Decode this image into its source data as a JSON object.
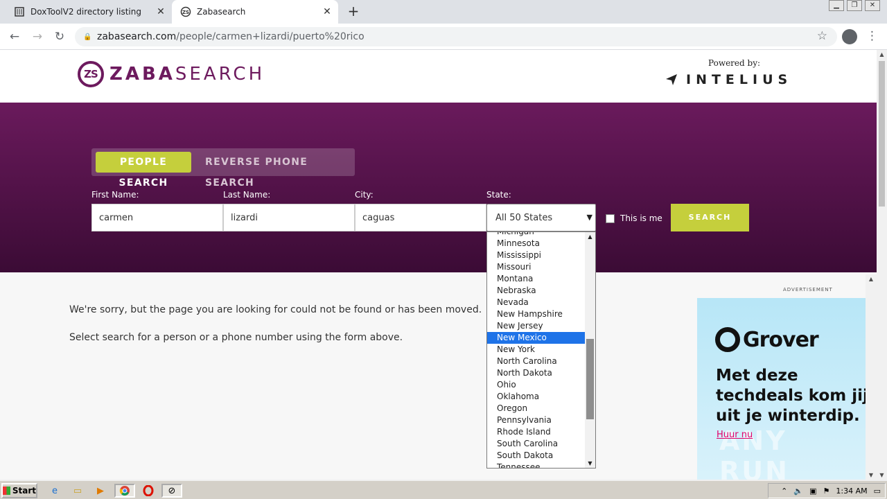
{
  "browser": {
    "tabs": [
      {
        "title": "DoxToolV2 directory listing",
        "icon": "archive-icon"
      },
      {
        "title": "Zabasearch",
        "icon": "zabasearch-favicon"
      }
    ],
    "url_host": "zabasearch.com",
    "url_path": "/people/carmen+lizardi/puerto%20rico"
  },
  "header": {
    "logo_mark": "ZS",
    "logo_bold": "ZABA",
    "logo_light": "SEARCH",
    "powered_by": "Powered by:",
    "partner": "INTELIUS"
  },
  "search": {
    "tab_active": "PEOPLE SEARCH",
    "tab_inactive": "REVERSE PHONE SEARCH",
    "first_name_label": "First Name:",
    "first_name_value": "carmen",
    "last_name_label": "Last Name:",
    "last_name_value": "lizardi",
    "city_label": "City:",
    "city_value": "caguas",
    "state_label": "State:",
    "state_value": "All 50 States",
    "this_is_me": "This is me",
    "button": "SEARCH"
  },
  "state_options": [
    "Michigan",
    "Minnesota",
    "Mississippi",
    "Missouri",
    "Montana",
    "Nebraska",
    "Nevada",
    "New Hampshire",
    "New Jersey",
    "New Mexico",
    "New York",
    "North Carolina",
    "North Dakota",
    "Ohio",
    "Oklahoma",
    "Oregon",
    "Pennsylvania",
    "Rhode Island",
    "South Carolina",
    "South Dakota",
    "Tennessee"
  ],
  "highlighted_option": "New Mexico",
  "content": {
    "message1": "We're sorry, but the page you are looking for could not be found or has been moved.",
    "message2": "Select search for a person or a phone number using the form above."
  },
  "ad": {
    "label": "ADVERTISEMENT",
    "brand": "Grover",
    "headline": "Met deze techdeals kom jij uit je winterdip.",
    "cta": "Huur nu",
    "watermark": "ANY RUN"
  },
  "taskbar": {
    "start": "Start",
    "clock": "1:34 AM"
  },
  "colors": {
    "brand_purple": "#6d1a5e",
    "accent_green": "#c5cf3c",
    "select_blue": "#1e73e8"
  }
}
